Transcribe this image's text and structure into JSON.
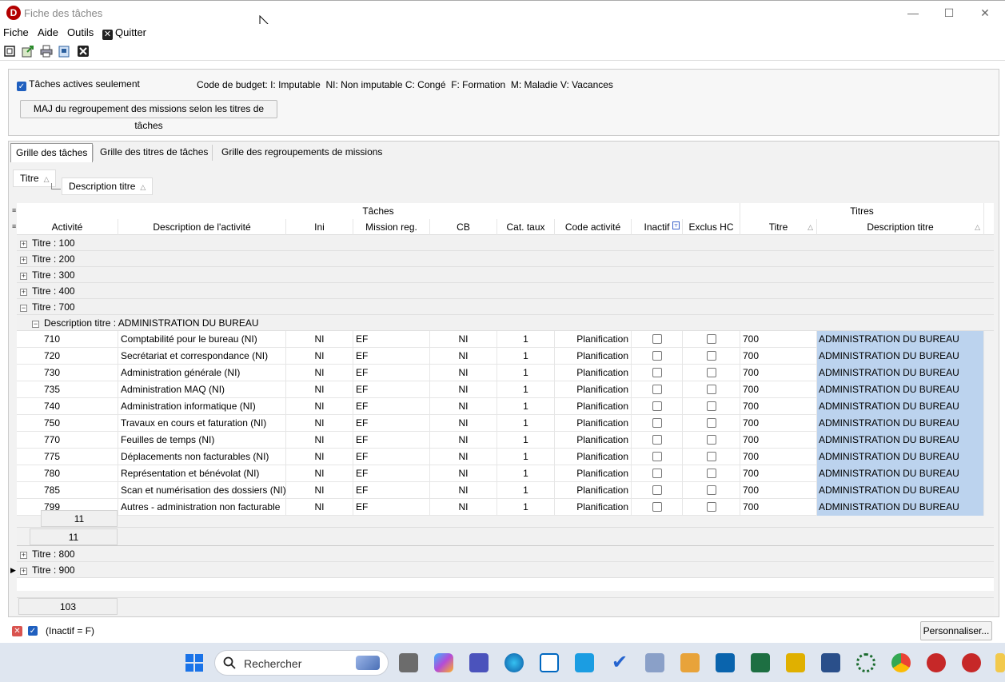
{
  "window": {
    "title": "Fiche des tâches",
    "app_icon_letter": "D"
  },
  "menu": {
    "fiche": "Fiche",
    "aide": "Aide",
    "outils": "Outils",
    "quitter": "Quitter"
  },
  "filters": {
    "active_only_label": "Tâches actives seulement",
    "active_only_checked": true,
    "budget_legend": "Code de budget: I: Imputable  NI: Non imputable C: Congé  F: Formation  M: Maladie V: Vacances",
    "update_button": "MAJ du regroupement des missions selon les titres de tâches"
  },
  "tabs": [
    "Grille des tâches",
    "Grille des titres de tâches",
    "Grille des regroupements de missions"
  ],
  "group_by": {
    "chip1": "Titre",
    "chip2": "Description titre"
  },
  "bands": {
    "taches": "Tâches",
    "titres": "Titres"
  },
  "columns": [
    "Activité",
    "Description de l'activité",
    "Ini",
    "Mission reg.",
    "CB",
    "Cat. taux",
    "Code activité",
    "Inactif",
    "Exclus HC",
    "Titre",
    "Description titre"
  ],
  "groups_top": [
    "Titre : 100",
    "Titre : 200",
    "Titre : 300",
    "Titre : 400"
  ],
  "group_open": "Titre : 700",
  "subgroup": "Description titre : ADMINISTRATION DU BUREAU",
  "rows": [
    {
      "act": "710",
      "desc": "Comptabilité pour le bureau (NI)",
      "ini": "NI",
      "mission": "EF",
      "cb": "NI",
      "cat": "1",
      "code": "Planification",
      "titre": "700",
      "dtitre": "ADMINISTRATION DU BUREAU"
    },
    {
      "act": "720",
      "desc": "Secrétariat et correspondance (NI)",
      "ini": "NI",
      "mission": "EF",
      "cb": "NI",
      "cat": "1",
      "code": "Planification",
      "titre": "700",
      "dtitre": "ADMINISTRATION DU BUREAU"
    },
    {
      "act": "730",
      "desc": "Administration générale (NI)",
      "ini": "NI",
      "mission": "EF",
      "cb": "NI",
      "cat": "1",
      "code": "Planification",
      "titre": "700",
      "dtitre": "ADMINISTRATION DU BUREAU"
    },
    {
      "act": "735",
      "desc": "Administration MAQ (NI)",
      "ini": "NI",
      "mission": "EF",
      "cb": "NI",
      "cat": "1",
      "code": "Planification",
      "titre": "700",
      "dtitre": "ADMINISTRATION DU BUREAU"
    },
    {
      "act": "740",
      "desc": "Administration informatique (NI)",
      "ini": "NI",
      "mission": "EF",
      "cb": "NI",
      "cat": "1",
      "code": "Planification",
      "titre": "700",
      "dtitre": "ADMINISTRATION DU BUREAU"
    },
    {
      "act": "750",
      "desc": "Travaux en cours et faturation (NI)",
      "ini": "NI",
      "mission": "EF",
      "cb": "NI",
      "cat": "1",
      "code": "Planification",
      "titre": "700",
      "dtitre": "ADMINISTRATION DU BUREAU"
    },
    {
      "act": "770",
      "desc": "Feuilles de temps (NI)",
      "ini": "NI",
      "mission": "EF",
      "cb": "NI",
      "cat": "1",
      "code": "Planification",
      "titre": "700",
      "dtitre": "ADMINISTRATION DU BUREAU"
    },
    {
      "act": "775",
      "desc": "Déplacements non facturables (NI)",
      "ini": "NI",
      "mission": "EF",
      "cb": "NI",
      "cat": "1",
      "code": "Planification",
      "titre": "700",
      "dtitre": "ADMINISTRATION DU BUREAU"
    },
    {
      "act": "780",
      "desc": "Représentation et bénévolat (NI)",
      "ini": "NI",
      "mission": "EF",
      "cb": "NI",
      "cat": "1",
      "code": "Planification",
      "titre": "700",
      "dtitre": "ADMINISTRATION DU BUREAU"
    },
    {
      "act": "785",
      "desc": "Scan et numérisation des dossiers (NI)",
      "ini": "NI",
      "mission": "EF",
      "cb": "NI",
      "cat": "1",
      "code": "Planification",
      "titre": "700",
      "dtitre": "ADMINISTRATION DU BUREAU"
    },
    {
      "act": "799",
      "desc": "Autres - administration non facturable",
      "ini": "NI",
      "mission": "EF",
      "cb": "NI",
      "cat": "1",
      "code": "Planification",
      "titre": "700",
      "dtitre": "ADMINISTRATION DU BUREAU"
    }
  ],
  "subgroup_count": "11",
  "group_count": "11",
  "groups_bottom": [
    "Titre : 800",
    "Titre : 900"
  ],
  "total_count": "103",
  "status": {
    "filter_text": "(Inactif = F)",
    "customize_button": "Personnaliser..."
  },
  "taskbar": {
    "search_placeholder": "Rechercher"
  },
  "colors": {
    "selected_cell": "#bcd3ee",
    "check_blue": "#1f5fbf",
    "app_red": "#b30000"
  }
}
